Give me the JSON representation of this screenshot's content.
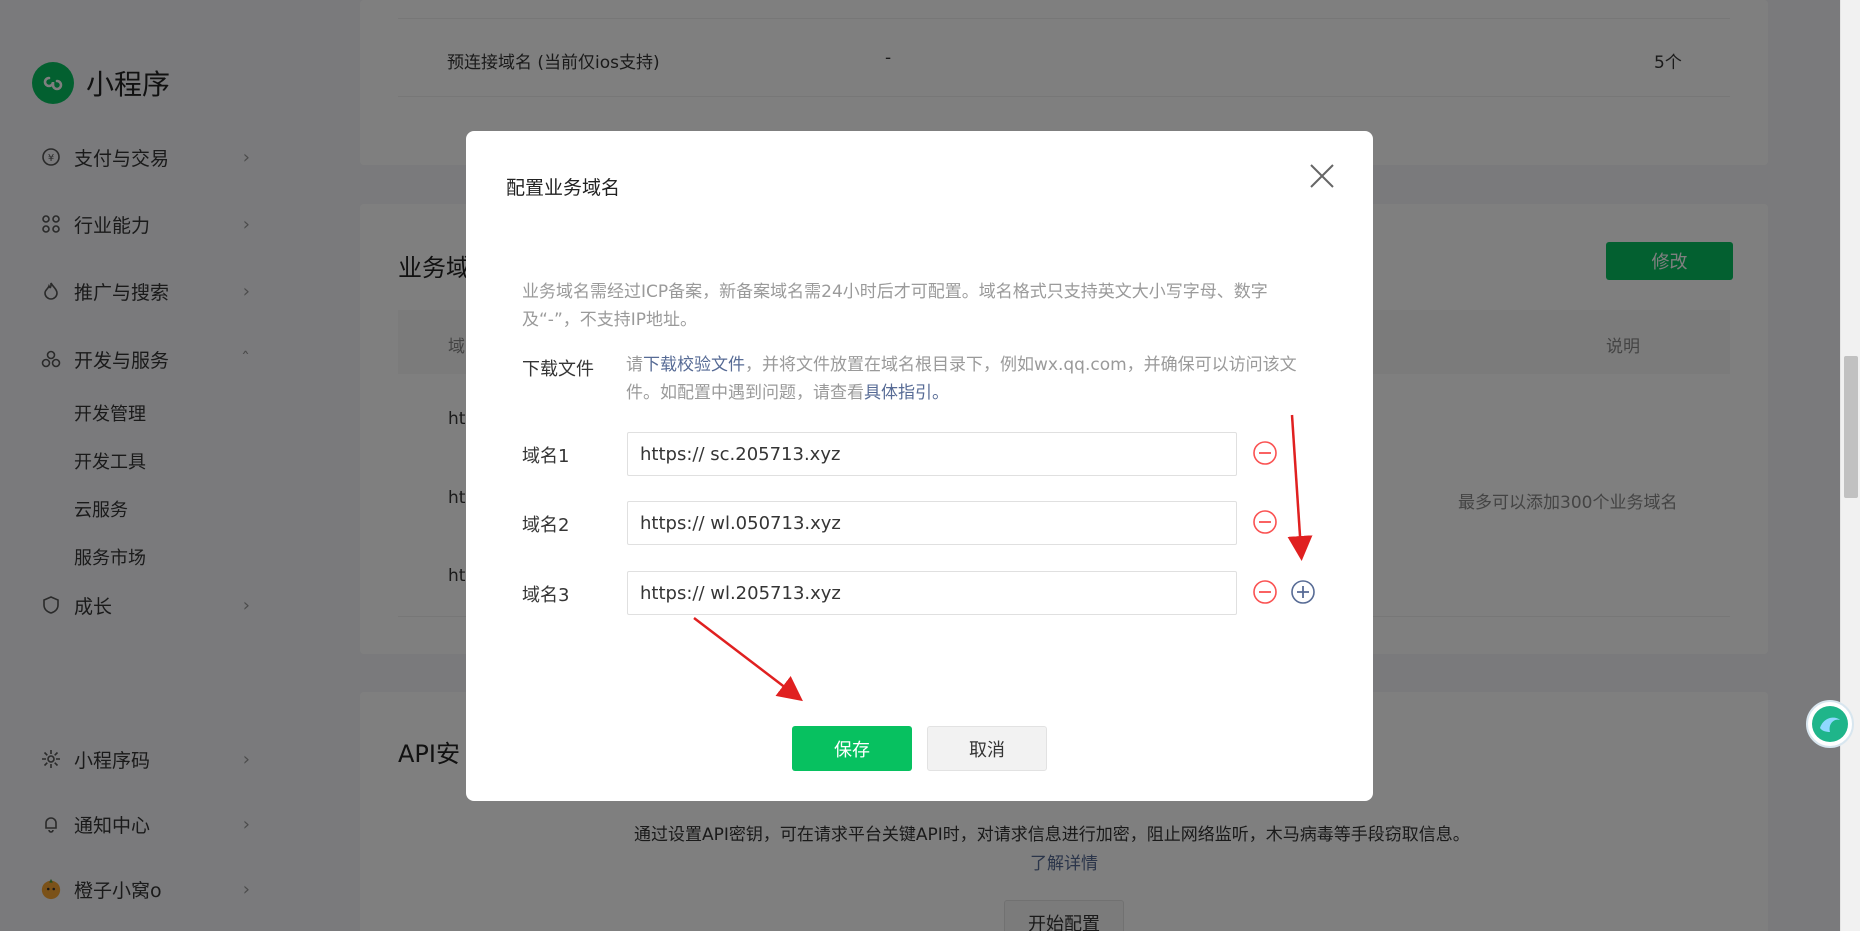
{
  "app": {
    "title": "小程序"
  },
  "sidebar": {
    "items": [
      {
        "label": "支付与交易"
      },
      {
        "label": "行业能力"
      },
      {
        "label": "推广与搜索"
      },
      {
        "label": "开发与服务"
      },
      {
        "label": "成长"
      },
      {
        "label": "小程序码"
      },
      {
        "label": "通知中心"
      },
      {
        "label": "橙子小窝o"
      }
    ],
    "sub_items": [
      {
        "label": "开发管理"
      },
      {
        "label": "开发工具"
      },
      {
        "label": "云服务"
      },
      {
        "label": "服务市场"
      }
    ]
  },
  "background": {
    "preconnect": {
      "name": "预连接域名 (当前仅ios支持)",
      "value": "-",
      "count": "5个"
    },
    "business_domain": {
      "title": "业务域",
      "modify_label": "修改",
      "col_domain": "域",
      "col_note": "说明",
      "rows": [
        "ht",
        "ht",
        "ht"
      ],
      "note": "最多可以添加300个业务域名"
    },
    "api_section": {
      "title": "API安",
      "desc": "通过设置API密钥，可在请求平台关键API时，对请求信息进行加密，阻止网络监听，木马病毒等手段窃取信息。",
      "detail_link": "了解详情",
      "start_label": "开始配置"
    }
  },
  "dialog": {
    "title": "配置业务域名",
    "tip": "业务域名需经过ICP备案，新备案域名需24小时后才可配置。域名格式只支持英文大小写字母、数字及“-”，不支持IP地址。",
    "download": {
      "label": "下载文件",
      "pre": "请",
      "link": "下载校验文件",
      "mid": "，并将文件放置在域名根目录下，例如wx.qq.com，并确保可以访问该文件。如配置中遇到问题，请查看",
      "guide_link": "具体指引。"
    },
    "domains": [
      {
        "label": "域名1",
        "value": "https:// sc.205713.xyz"
      },
      {
        "label": "域名2",
        "value": "https:// wl.050713.xyz"
      },
      {
        "label": "域名3",
        "value": "https:// wl.205713.xyz"
      }
    ],
    "save_label": "保存",
    "cancel_label": "取消"
  },
  "colors": {
    "brand": "#07c160",
    "link": "#576b95",
    "danger": "#fa5151",
    "arrow": "#e02020"
  }
}
